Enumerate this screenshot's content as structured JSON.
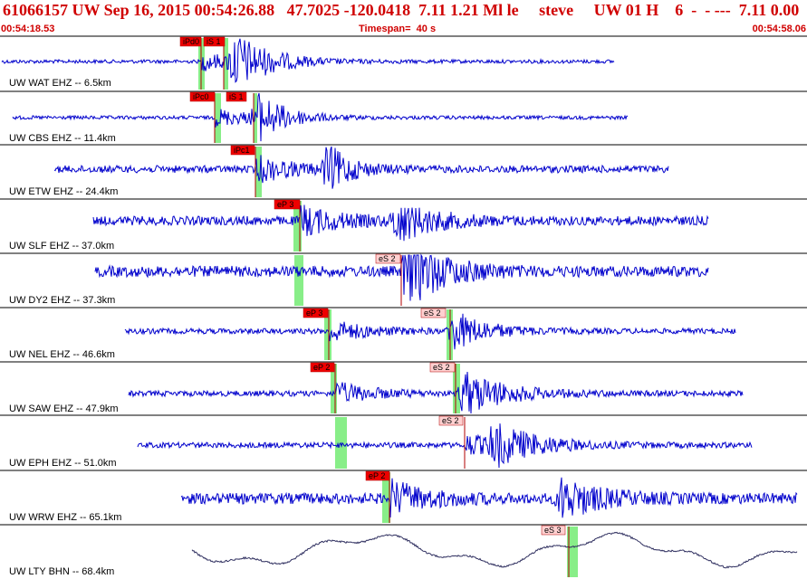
{
  "header": {
    "title": "61066157 UW Sep 16, 2015 00:54:26.88   47.7025 -120.0418  7.11 1.21 Ml le     steve     UW 01 H    6  -  - ---  7.11 0.00",
    "start_time": "00:54:18.53",
    "timespan": "Timespan=  40 s",
    "end_time": "00:54:58.06"
  },
  "colors": {
    "trace": "#0000cc",
    "pick_box": "#ee0000",
    "pick_box_light": "#ffd0d0",
    "pick_line": "#b00000",
    "window": "#88ee88",
    "header_text": "#d00000",
    "divider": "#000000",
    "lty_trace": "#303060"
  },
  "channels": [
    {
      "label": "UW WAT EHZ -- 6.5km",
      "picks": [
        {
          "text": "iPd0"
        },
        {
          "text": "iS 1"
        }
      ]
    },
    {
      "label": "UW CBS EHZ -- 11.4km",
      "picks": [
        {
          "text": "iPc0"
        },
        {
          "text": "iS 1"
        }
      ]
    },
    {
      "label": "UW ETW EHZ -- 24.4km",
      "picks": [
        {
          "text": "iPc1"
        }
      ]
    },
    {
      "label": "UW SLF EHZ -- 37.0km",
      "picks": [
        {
          "text": "eP 3"
        }
      ]
    },
    {
      "label": "UW DY2 EHZ -- 37.3km",
      "picks": [
        {
          "text": "eS 2"
        }
      ]
    },
    {
      "label": "UW NEL EHZ -- 46.6km",
      "picks": [
        {
          "text": "eP 3"
        },
        {
          "text": "eS 2"
        }
      ]
    },
    {
      "label": "UW SAW EHZ -- 47.9km",
      "picks": [
        {
          "text": "eP 2"
        },
        {
          "text": "eS 2"
        }
      ]
    },
    {
      "label": "UW EPH EHZ -- 51.0km",
      "picks": [
        {
          "text": "eS 2"
        }
      ]
    },
    {
      "label": "UW WRW EHZ -- 65.1km",
      "picks": [
        {
          "text": "eP 2"
        }
      ]
    },
    {
      "label": "UW LTY BHN -- 68.4km",
      "picks": [
        {
          "text": "eS 3"
        }
      ]
    }
  ]
}
